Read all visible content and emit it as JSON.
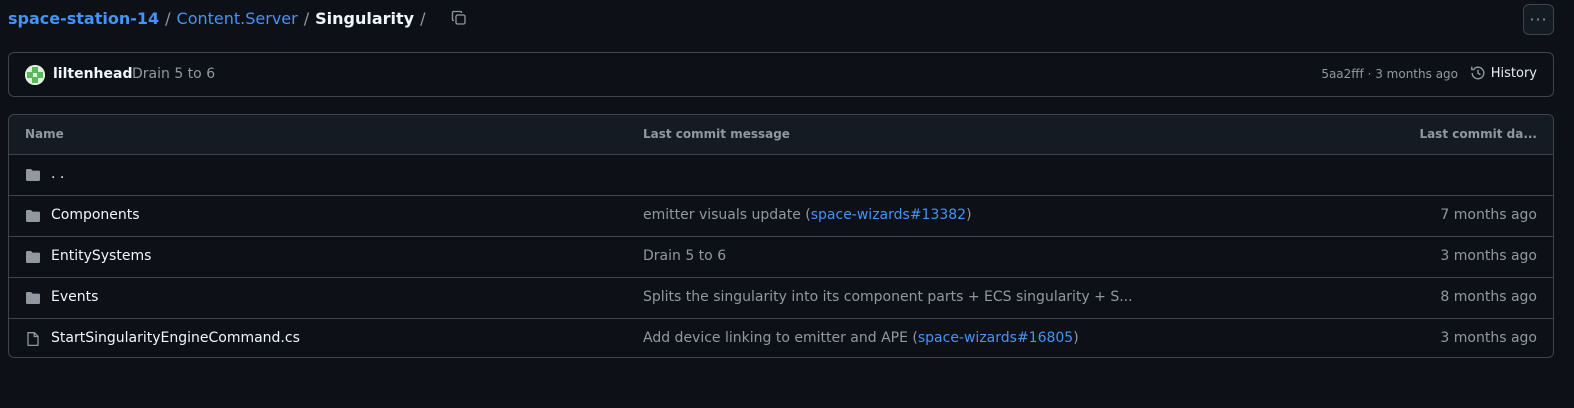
{
  "breadcrumb": {
    "repo": "space-station-14",
    "folder": "Content.Server",
    "current": "Singularity",
    "separator": "/"
  },
  "more_button": "···",
  "latest_commit": {
    "author": "liltenhead",
    "message": "Drain 5 to 6",
    "sha_time": "5aa2fff · 3 months ago",
    "history_label": "History"
  },
  "table": {
    "headers": {
      "name": "Name",
      "message": "Last commit message",
      "date": "Last commit da..."
    },
    "parent_label": ". .",
    "rows": [
      {
        "type": "folder",
        "name": "Components",
        "msg_before": "emitter visuals update (",
        "msg_link": "space-wizards#13382",
        "msg_after": ")",
        "date": "7 months ago"
      },
      {
        "type": "folder",
        "name": "EntitySystems",
        "msg_before": "Drain 5 to 6",
        "msg_link": "",
        "msg_after": "",
        "date": "3 months ago"
      },
      {
        "type": "folder",
        "name": "Events",
        "msg_before": "Splits the singularity into its component parts + ECS singularity + S...",
        "msg_link": "",
        "msg_after": "",
        "date": "8 months ago"
      },
      {
        "type": "file",
        "name": "StartSingularityEngineCommand.cs",
        "msg_before": "Add device linking to emitter and APE (",
        "msg_link": "space-wizards#16805",
        "msg_after": ")",
        "date": "3 months ago"
      }
    ]
  },
  "colors": {
    "background": "#0d1117",
    "link": "#4493f8",
    "border": "#3d444d",
    "muted": "#9198a1"
  }
}
